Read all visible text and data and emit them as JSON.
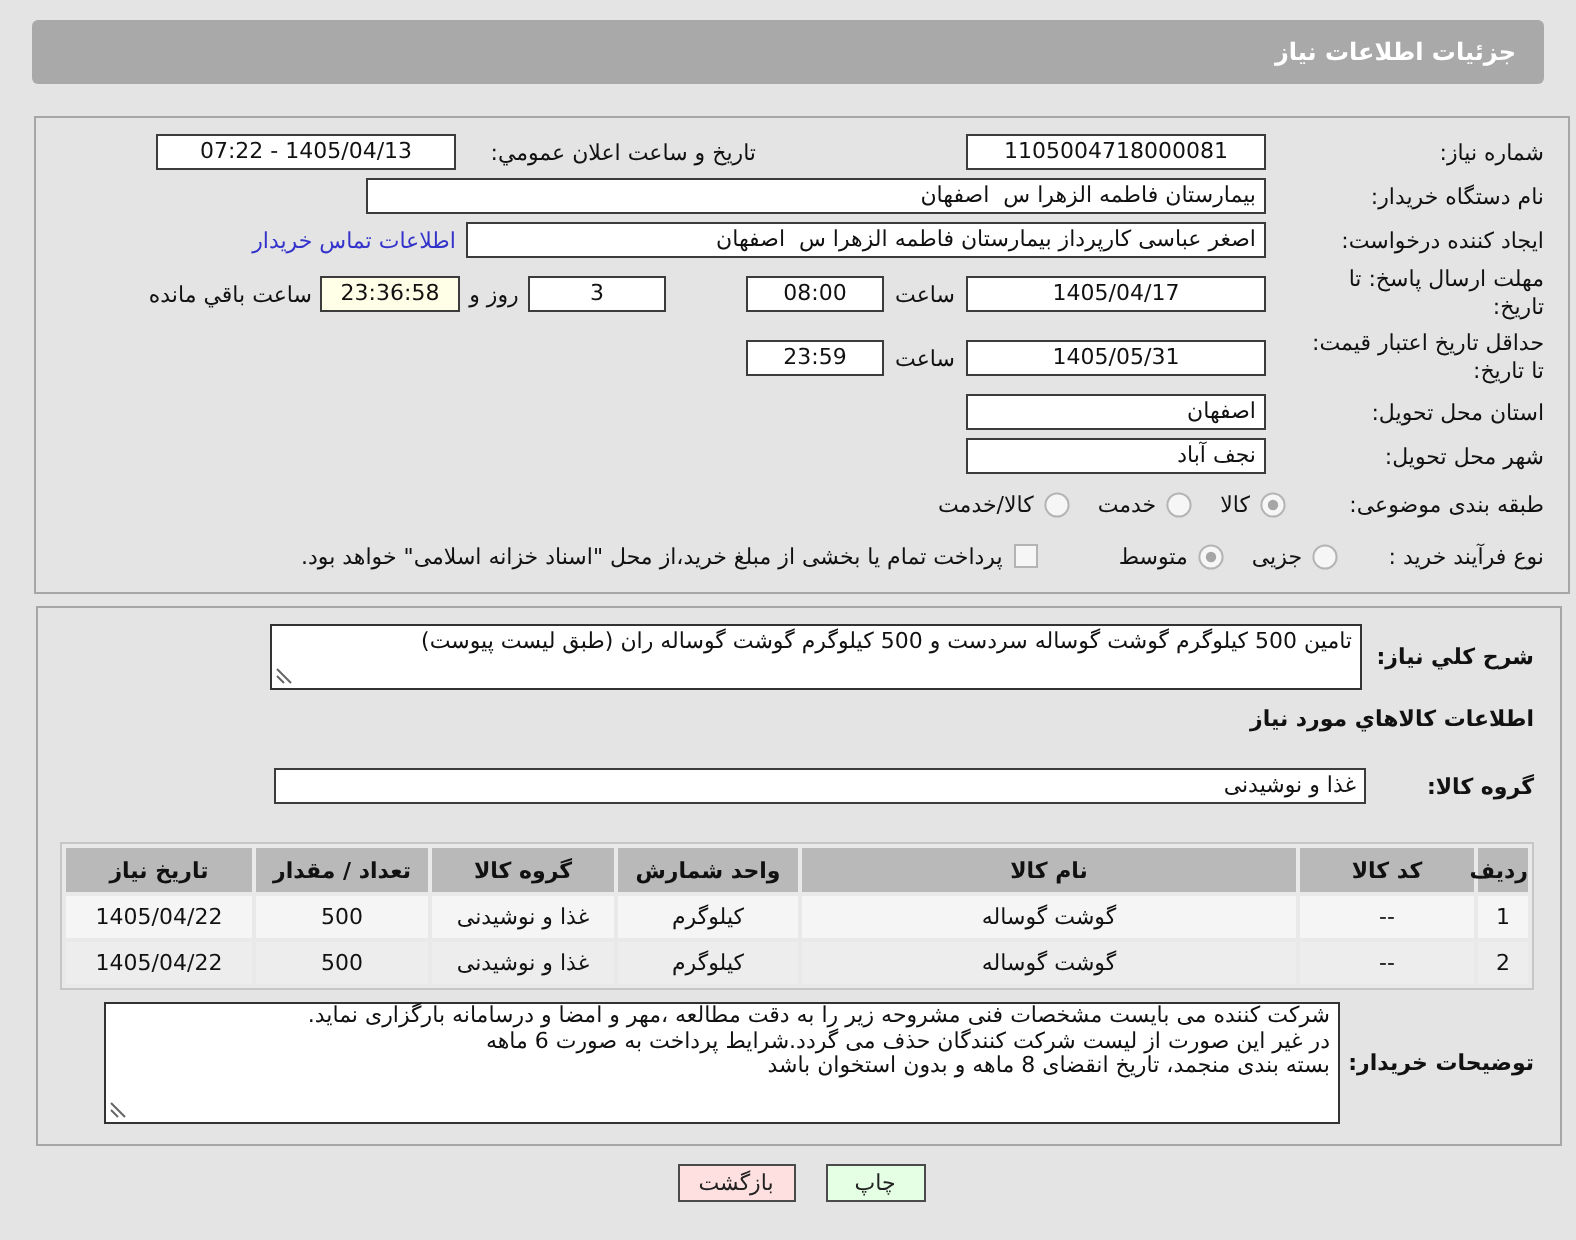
{
  "header": {
    "title": "جزئیات اطلاعات نیاز"
  },
  "need_number": {
    "label": "شماره نیاز:",
    "value": "1105004718000081"
  },
  "announce": {
    "label": "تاریخ و ساعت اعلان عمومي:",
    "value": "1405/04/13 - 07:22"
  },
  "buyer_org": {
    "label": "نام دستگاه خریدار:",
    "value": "بیمارستان فاطمه الزهرا س  اصفهان"
  },
  "requester": {
    "label": "ایجاد کننده درخواست:",
    "value": "اصغر عباسی کارپرداز بیمارستان فاطمه الزهرا س  اصفهان",
    "link": "اطلاعات تماس خریدار"
  },
  "reply_deadline": {
    "label": "مهلت ارسال پاسخ: تا تاریخ:",
    "date": "1405/04/17",
    "time_label": "ساعت",
    "time": "08:00",
    "days": "3",
    "days_label": "روز و",
    "remaining": "23:36:58",
    "remaining_label": "ساعت باقي مانده"
  },
  "price_validity": {
    "label": "حداقل تاریخ اعتبار قیمت: تا تاریخ:",
    "date": "1405/05/31",
    "time_label": "ساعت",
    "time": "23:59"
  },
  "province": {
    "label": "استان محل تحویل:",
    "value": "اصفهان"
  },
  "city": {
    "label": "شهر محل تحویل:",
    "value": "نجف آباد"
  },
  "category": {
    "label": "طبقه بندی موضوعی:",
    "options": [
      {
        "label": "کالا",
        "selected": true
      },
      {
        "label": "خدمت",
        "selected": false
      },
      {
        "label": "کالا/خدمت",
        "selected": false
      }
    ]
  },
  "process": {
    "label": "نوع فرآیند خرید :",
    "options": [
      {
        "label": "جزیی",
        "selected": false
      },
      {
        "label": "متوسط",
        "selected": true
      }
    ],
    "treasury": {
      "label": "پرداخت تمام یا بخشی از مبلغ خرید،از محل \"اسناد خزانه اسلامی\" خواهد بود.",
      "checked": false
    }
  },
  "description": {
    "label": "شرح کلي نیاز:",
    "value": "تامین  500 کیلوگرم گوشت گوساله  سردست و  500 کیلوگرم گوشت گوساله ران (طبق لیست پیوست)"
  },
  "goods_title": "اطلاعات کالاهاي مورد نیاز",
  "goods_group": {
    "label": "گروه کالا:",
    "value": "غذا و نوشیدنی"
  },
  "table": {
    "columns": [
      "ردیف",
      "کد کالا",
      "نام کالا",
      "واحد شمارش",
      "گروه کالا",
      "تعداد / مقدار",
      "تاریخ نیاز"
    ],
    "rows": [
      [
        "1",
        "--",
        "گوشت گوساله",
        "کیلوگرم",
        "غذا و نوشیدنی",
        "500",
        "1405/04/22"
      ],
      [
        "2",
        "--",
        "گوشت گوساله",
        "کیلوگرم",
        "غذا و نوشیدنی",
        "500",
        "1405/04/22"
      ]
    ]
  },
  "buyer_notes": {
    "label": "توضیحات خریدار:",
    "lines": [
      "شرکت کننده می بایست مشخصات فنی مشروحه زیر را به دقت مطالعه ،مهر و امضا و درسامانه بارگزاری نماید.",
      "در غیر این صورت از لیست شرکت کنندگان حذف می گردد.شرایط پرداخت به صورت 6 ماهه",
      "بسته بندی منجمد، تاریخ انقضای 8 ماهه و بدون استخوان باشد"
    ]
  },
  "buttons": [
    {
      "label": "چاپ",
      "kind": "print"
    },
    {
      "label": "بازگشت",
      "kind": "back"
    }
  ]
}
